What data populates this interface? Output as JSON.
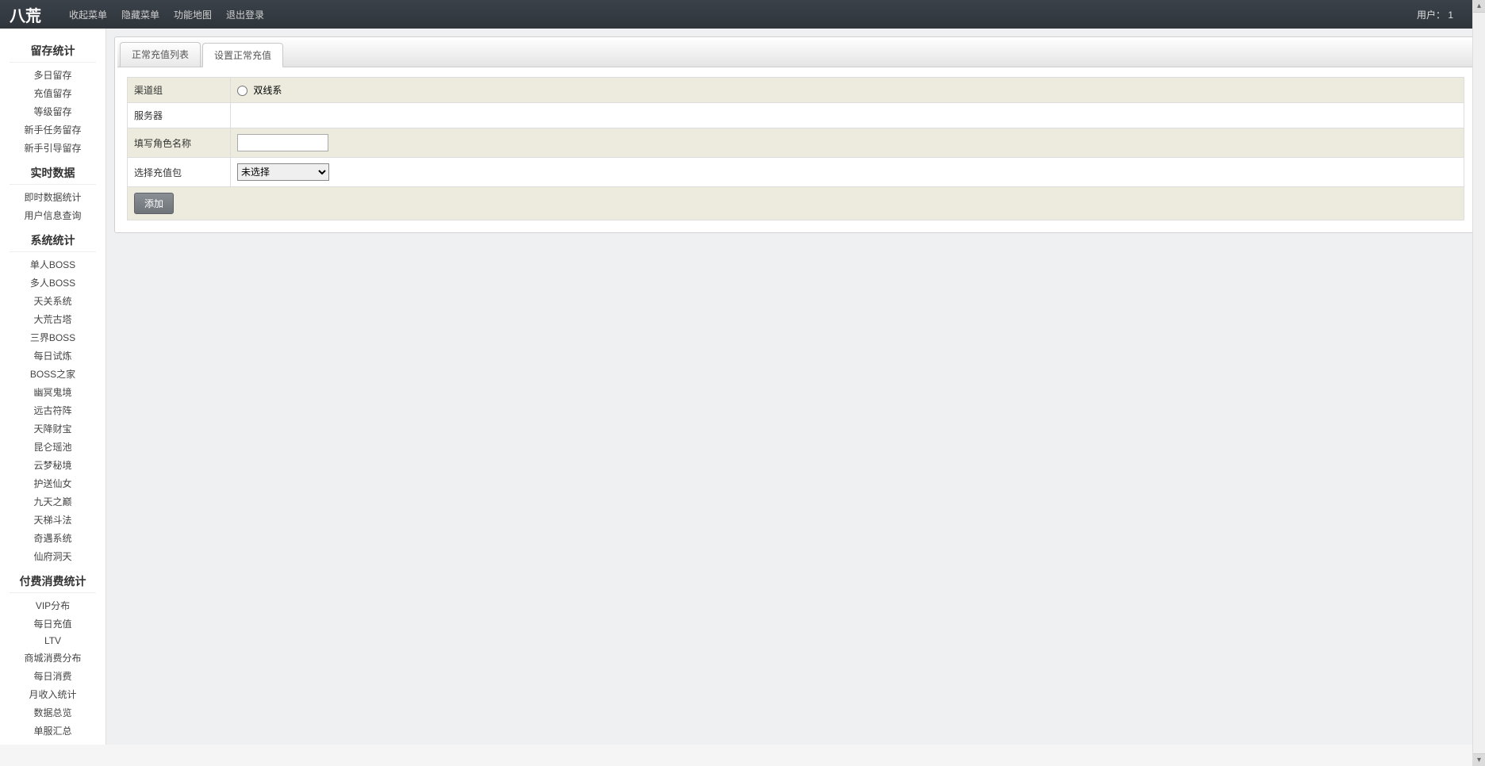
{
  "brand": "八荒",
  "top_nav": {
    "collapse": "收起菜单",
    "hide": "隐藏菜单",
    "sitemap": "功能地图",
    "logout": "退出登录"
  },
  "user_label": "用户：",
  "user_value": "1",
  "sidebar": [
    {
      "title": "留存统计",
      "items": [
        "多日留存",
        "充值留存",
        "等级留存",
        "新手任务留存",
        "新手引导留存"
      ]
    },
    {
      "title": "实时数据",
      "items": [
        "即时数据统计",
        "用户信息查询"
      ]
    },
    {
      "title": "系统统计",
      "items": [
        "单人BOSS",
        "多人BOSS",
        "天关系统",
        "大荒古塔",
        "三界BOSS",
        "每日试炼",
        "BOSS之家",
        "幽冥鬼境",
        "远古符阵",
        "天降财宝",
        "昆仑瑶池",
        "云梦秘境",
        "护送仙女",
        "九天之巅",
        "天梯斗法",
        "奇遇系统",
        "仙府洞天"
      ]
    },
    {
      "title": "付费消费统计",
      "items": [
        "VIP分布",
        "每日充值",
        "LTV",
        "商城消费分布",
        "每日消费",
        "月收入统计",
        "数据总览",
        "单服汇总"
      ]
    }
  ],
  "tabs": {
    "list": "正常充值列表",
    "set": "设置正常充值"
  },
  "form": {
    "channel_group": "渠道组",
    "channel_option": "双线系",
    "server": "服务器",
    "role_name": "填写角色名称",
    "select_package": "选择充值包",
    "select_default": "未选择",
    "add_btn": "添加"
  }
}
